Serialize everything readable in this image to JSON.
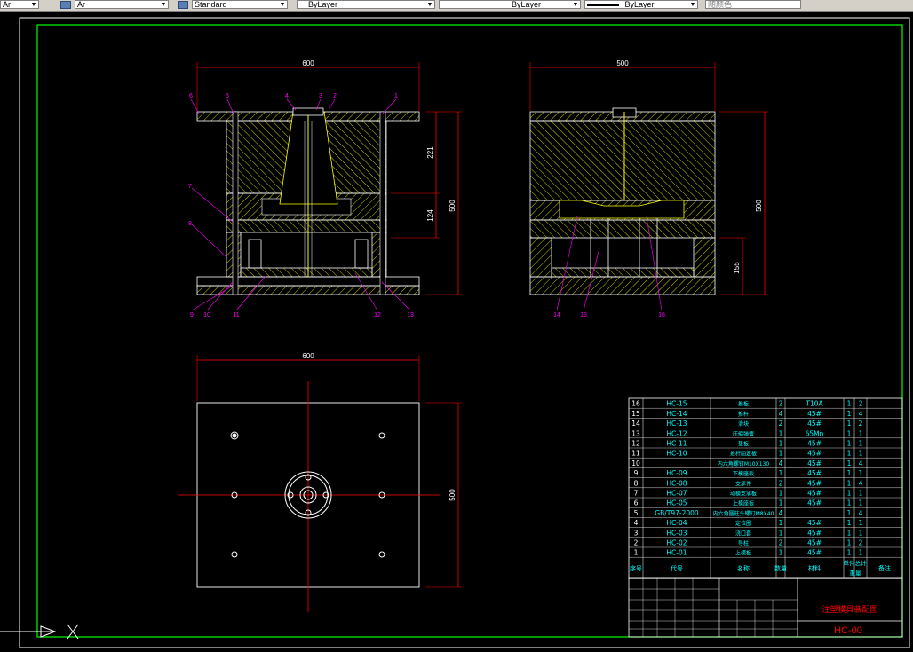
{
  "toolbar": {
    "layer_fragment": "Ar",
    "style_fragment": "Standard",
    "color_value": "ByLayer",
    "linetype_value": "ByLayer",
    "lineweight_value": "ByLayer",
    "plotstyle_value": "随颜色"
  },
  "views": {
    "front": {
      "width_dim": "600",
      "height_dim": "500",
      "dim_upper": "221",
      "dim_lower": "124",
      "callouts": [
        "6",
        "5",
        "4",
        "3",
        "2",
        "1",
        "7",
        "8",
        "9",
        "10",
        "11",
        "12",
        "13"
      ]
    },
    "side": {
      "width_dim": "500",
      "height_dim": "500",
      "dim_lower": "155",
      "callouts": [
        "14",
        "15",
        "16"
      ]
    },
    "top": {
      "width_dim": "600",
      "height_dim": "500"
    }
  },
  "bom": {
    "rows": [
      {
        "no": "16",
        "code": "HC-15",
        "name": "推板",
        "qty": "2",
        "material": "T10A",
        "unit": "1",
        "total": "2"
      },
      {
        "no": "15",
        "code": "HC-14",
        "name": "推杆",
        "qty": "4",
        "material": "45#",
        "unit": "1",
        "total": "4"
      },
      {
        "no": "14",
        "code": "HC-13",
        "name": "滑块",
        "qty": "2",
        "material": "45#",
        "unit": "1",
        "total": "2"
      },
      {
        "no": "13",
        "code": "HC-12",
        "name": "压缩弹簧",
        "qty": "1",
        "material": "65Mn",
        "unit": "1",
        "total": "1"
      },
      {
        "no": "12",
        "code": "HC-11",
        "name": "垫板",
        "qty": "1",
        "material": "45#",
        "unit": "1",
        "total": "1"
      },
      {
        "no": "11",
        "code": "HC-10",
        "name": "推杆固定板",
        "qty": "1",
        "material": "45#",
        "unit": "1",
        "total": "1"
      },
      {
        "no": "10",
        "code": "",
        "name": "内六角螺钉M10X130",
        "qty": "4",
        "material": "45#",
        "unit": "1",
        "total": "4"
      },
      {
        "no": "9",
        "code": "HC-09",
        "name": "下模座板",
        "qty": "1",
        "material": "45#",
        "unit": "1",
        "total": "1"
      },
      {
        "no": "8",
        "code": "HC-08",
        "name": "支承件",
        "qty": "2",
        "material": "45#",
        "unit": "1",
        "total": "4"
      },
      {
        "no": "7",
        "code": "HC-07",
        "name": "动模支承板",
        "qty": "1",
        "material": "45#",
        "unit": "1",
        "total": "1"
      },
      {
        "no": "6",
        "code": "HC-05",
        "name": "上模座板",
        "qty": "1",
        "material": "45#",
        "unit": "1",
        "total": "1"
      },
      {
        "no": "5",
        "code": "GB/T97-2000",
        "name": "内六角圆柱头螺钉M8X40",
        "qty": "4",
        "material": "",
        "unit": "1",
        "total": "4"
      },
      {
        "no": "4",
        "code": "HC-04",
        "name": "定位圈",
        "qty": "1",
        "material": "45#",
        "unit": "1",
        "total": "1"
      },
      {
        "no": "3",
        "code": "HC-03",
        "name": "浇口套",
        "qty": "1",
        "material": "45#",
        "unit": "1",
        "total": "1"
      },
      {
        "no": "2",
        "code": "HC-02",
        "name": "导柱",
        "qty": "2",
        "material": "45#",
        "unit": "1",
        "total": "2"
      },
      {
        "no": "1",
        "code": "HC-01",
        "name": "上模板",
        "qty": "1",
        "material": "45#",
        "unit": "1",
        "total": "1"
      }
    ],
    "header": {
      "no": "序号",
      "code": "代号",
      "name": "名称",
      "qty": "数量",
      "material": "材料",
      "unit": "单件",
      "total": "总计",
      "weight": "重量",
      "remark": "备注"
    },
    "title": "注塑模具装配图",
    "drawing_no": "HC-00"
  },
  "colors": {
    "background": "#000000",
    "frame": "#00ff00",
    "outline": "#ffffff",
    "hatch": "#ffff00",
    "dimension": "#ff0000",
    "callout": "#ff00ff",
    "table_text": "#00ffff",
    "title_text": "#ff0000"
  }
}
